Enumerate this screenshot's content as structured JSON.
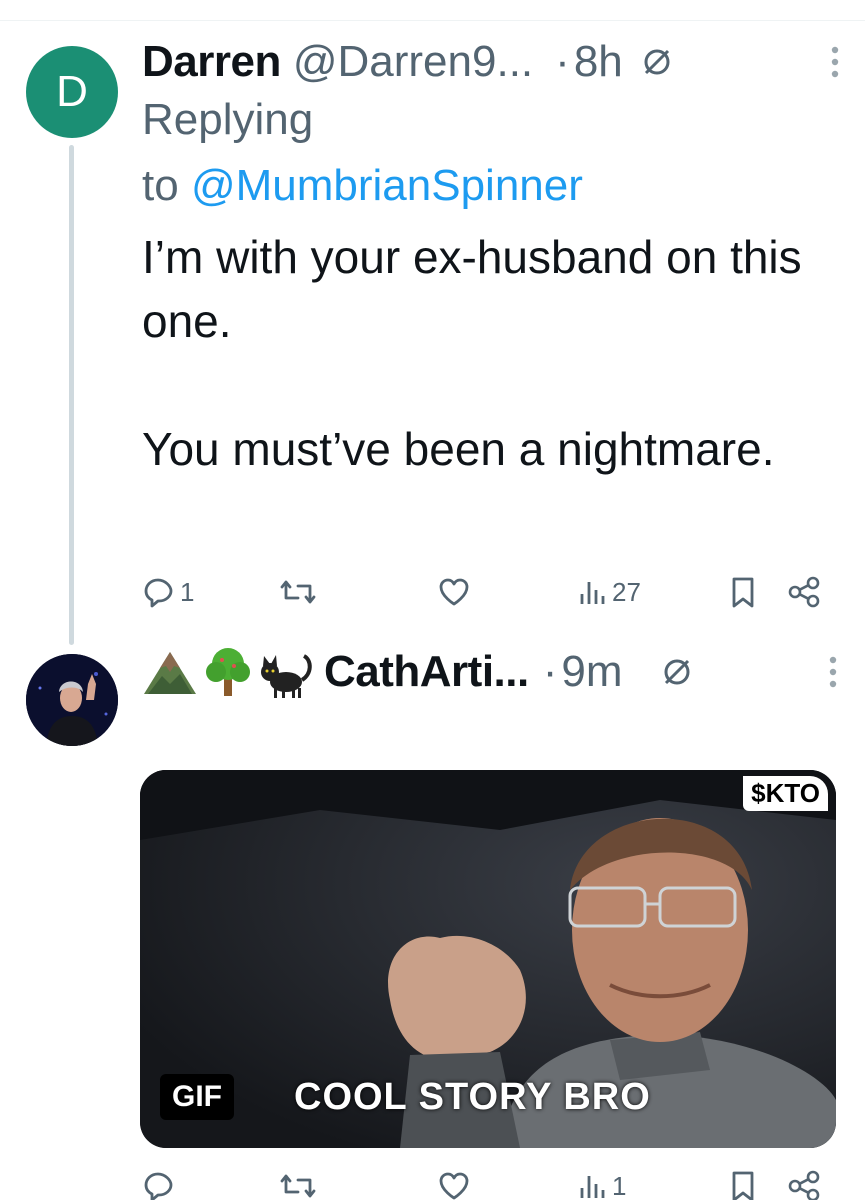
{
  "tweet1": {
    "avatar_letter": "D",
    "name": "Darren",
    "handle": "@Darren9...",
    "dot": "·",
    "time": "8h",
    "replying_label": "Replying",
    "to_label": "to",
    "replying_to_handle": "@MumbrianSpinner",
    "body_line1": "I’m with your ex-husband on this one.",
    "body_line2": "You must’ve been a nightmare.",
    "replies_count": "1",
    "views_count": "27"
  },
  "tweet2": {
    "emojis": [
      "mountain-emoji",
      "tree-emoji",
      "black-cat-emoji"
    ],
    "name": "CathArti...",
    "dot": "·",
    "time": "9m",
    "gif_badge": "GIF",
    "gif_caption": "COOL STORY BRO",
    "gif_ticker": "$KTO",
    "views_count": "1"
  },
  "colors": {
    "accent": "#1d9bf0",
    "secondary_text": "#536471",
    "avatar_d_bg": "#1b8f74",
    "thread_line": "#cfd9de"
  }
}
